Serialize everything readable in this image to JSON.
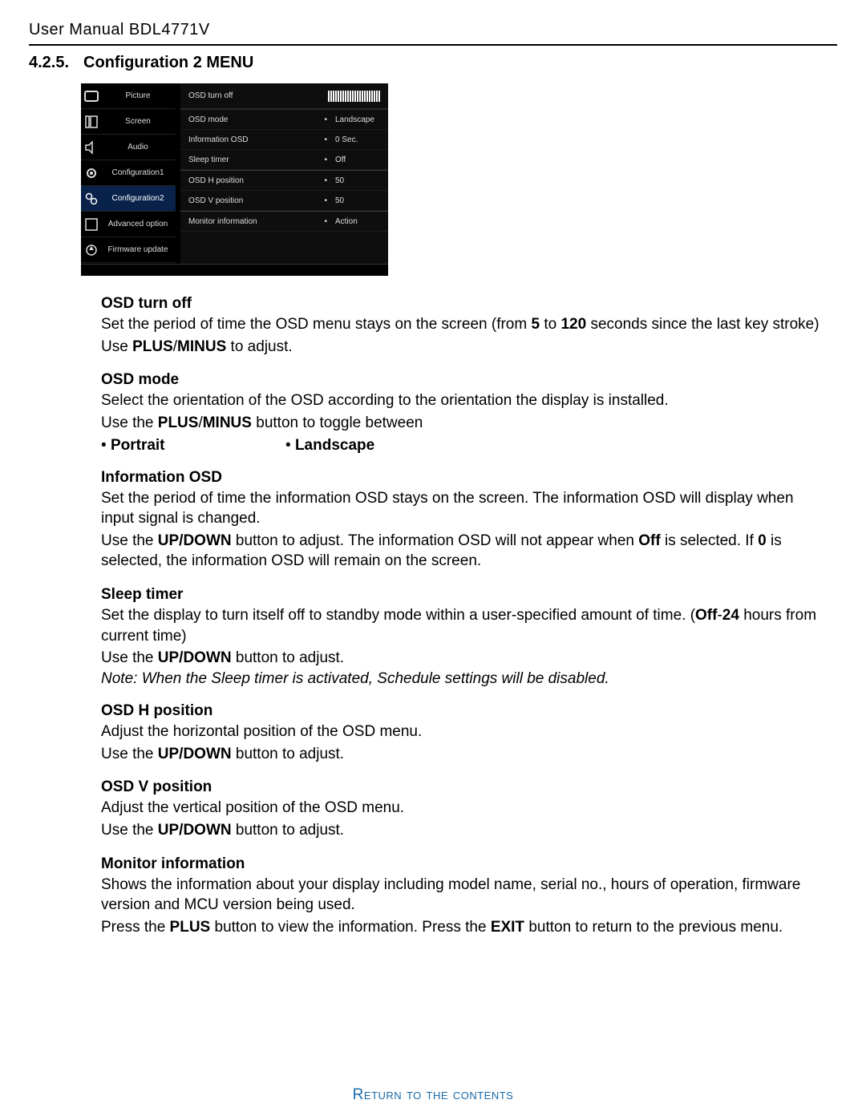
{
  "doc_title": "User Manual BDL4771V",
  "section": {
    "number": "4.2.5.",
    "title_prefix": "Configuration 2 ",
    "title_menu": "MENU"
  },
  "osd": {
    "side_items": [
      {
        "label": "Picture"
      },
      {
        "label": "Screen"
      },
      {
        "label": "Audio"
      },
      {
        "label": "Configuration1"
      },
      {
        "label": "Configuration2",
        "active": true
      },
      {
        "label": "Advanced option"
      },
      {
        "label": "Firmware update"
      }
    ],
    "header_label": "OSD turn off",
    "rows": [
      {
        "k": "OSD mode",
        "v": "Landscape"
      },
      {
        "k": "Information OSD",
        "v": "0 Sec."
      },
      {
        "k": "Sleep timer",
        "v": "Off"
      },
      {
        "k": "OSD H position",
        "v": "50",
        "sep": true
      },
      {
        "k": "OSD V position",
        "v": "50"
      },
      {
        "k": "Monitor information",
        "v": "Action",
        "sep": true
      }
    ]
  },
  "content": {
    "osd_turn_off_h": "OSD turn off",
    "osd_turn_off_1a": "Set the period of time the OSD menu stays on the screen (from ",
    "osd_turn_off_1b": "5",
    "osd_turn_off_1c": " to ",
    "osd_turn_off_1d": "120",
    "osd_turn_off_1e": " seconds since the last key stroke)",
    "osd_turn_off_2a": "Use ",
    "osd_turn_off_2b": "PLUS",
    "osd_turn_off_2c": "/",
    "osd_turn_off_2d": "MINUS",
    "osd_turn_off_2e": " to adjust.",
    "osd_mode_h": "OSD mode",
    "osd_mode_1": "Select the orientation of the OSD according to the orientation the display is installed.",
    "osd_mode_2a": "Use the ",
    "osd_mode_2b": "PLUS",
    "osd_mode_2c": "/",
    "osd_mode_2d": "MINUS",
    "osd_mode_2e": " button to toggle between",
    "osd_mode_opt1": "Portrait",
    "osd_mode_opt2": "Landscape",
    "info_osd_h": "Information OSD",
    "info_osd_1": "Set the period of time the information OSD stays on the screen. The information OSD will display when input signal is changed.",
    "info_osd_2a": "Use the ",
    "info_osd_2b": "UP/DOWN",
    "info_osd_2c": " button to adjust. The information OSD will not appear when ",
    "info_osd_2d": "Off",
    "info_osd_2e": " is selected. If ",
    "info_osd_2f": "0",
    "info_osd_2g": " is selected, the information OSD will remain on the screen.",
    "sleep_h": "Sleep timer",
    "sleep_1a": "Set the display to turn itself off to standby mode within a user-specified amount of time. (",
    "sleep_1b": "Off",
    "sleep_1c": "-",
    "sleep_1d": "24",
    "sleep_1e": " hours from current time)",
    "sleep_2a": "Use the ",
    "sleep_2b": "UP/DOWN",
    "sleep_2c": " button to adjust.",
    "sleep_note": "Note: When the Sleep timer is activated, Schedule settings will be disabled.",
    "hpos_h": "OSD H position",
    "hpos_1": "Adjust the horizontal position of the OSD menu.",
    "hpos_2a": "Use the ",
    "hpos_2b": "UP/DOWN",
    "hpos_2c": " button to adjust.",
    "vpos_h": "OSD V position",
    "vpos_1": "Adjust the vertical position of the OSD menu.",
    "vpos_2a": "Use the ",
    "vpos_2b": "UP/DOWN",
    "vpos_2c": " button to adjust.",
    "moninfo_h": "Monitor information",
    "moninfo_1": "Shows the information about your display including model name, serial no., hours of operation, firmware version and MCU version being used.",
    "moninfo_2a": "Press the ",
    "moninfo_2b": "PLUS",
    "moninfo_2c": " button to view the information. Press the ",
    "moninfo_2d": "EXIT",
    "moninfo_2e": " button to return to the previous menu."
  },
  "footer_link": "Return to the contents"
}
